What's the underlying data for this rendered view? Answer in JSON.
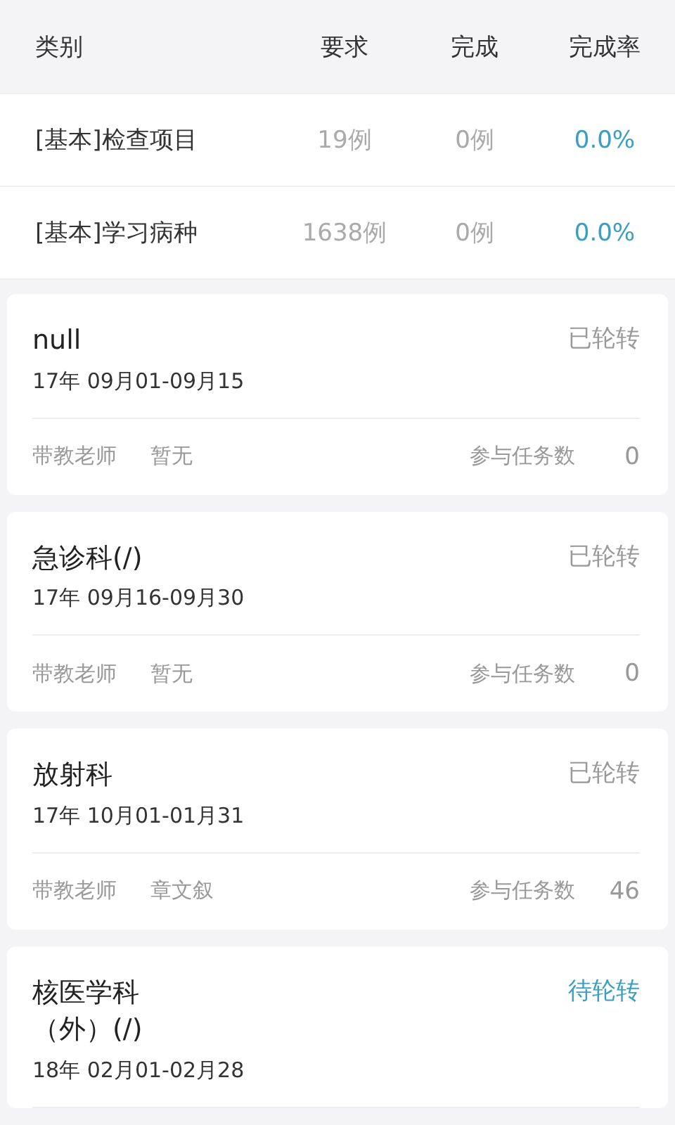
{
  "table": {
    "columns": [
      "类别",
      "要求",
      "完成",
      "完成率"
    ],
    "rows": [
      {
        "category": "[基本]检查项目",
        "required": "19例",
        "done": "0例",
        "rate": "0.0%"
      },
      {
        "category": "[基本]学习病种",
        "required": "1638例",
        "done": "0例",
        "rate": "0.0%"
      }
    ]
  },
  "rotations": [
    {
      "title": "null",
      "status": "已轮转",
      "kind": "done",
      "date": "17年  09月01-09月15",
      "teacher_label": "带教老师",
      "teacher": "暂无",
      "tasks_label": "参与任务数",
      "tasks": "0"
    },
    {
      "title": "急诊科(/)",
      "status": "已轮转",
      "kind": "done",
      "date": "17年  09月16-09月30",
      "teacher_label": "带教老师",
      "teacher": "暂无",
      "tasks_label": "参与任务数",
      "tasks": "0"
    },
    {
      "title": "放射科",
      "status": "已轮转",
      "kind": "done",
      "date": "17年  10月01-01月31",
      "teacher_label": "带教老师",
      "teacher": "章文叙",
      "tasks_label": "参与任务数",
      "tasks": "46"
    },
    {
      "title": "核医学科（外）(/)",
      "status": "待轮转",
      "kind": "pending",
      "date": "18年  02月01-02月28"
    }
  ]
}
